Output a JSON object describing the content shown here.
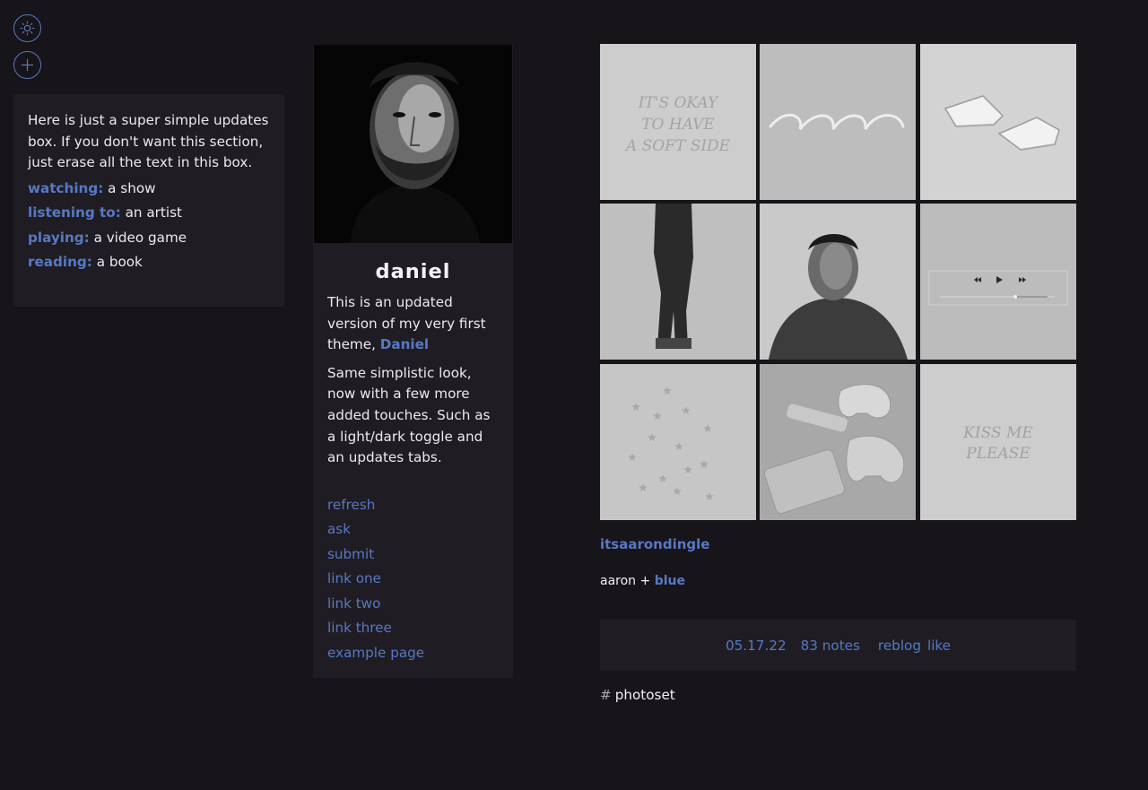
{
  "controls": {
    "theme_toggle_icon": "sun-icon",
    "updates_toggle_icon": "plus-icon",
    "accent_color": "#5878c4"
  },
  "updates": {
    "intro": "Here is just a super simple updates box. If you don't want this section, just erase all the text in this box.",
    "items": [
      {
        "label": "watching:",
        "value": "a show"
      },
      {
        "label": "listening to:",
        "value": "an artist"
      },
      {
        "label": "playing:",
        "value": "a video game"
      },
      {
        "label": "reading:",
        "value": "a book"
      }
    ]
  },
  "sidebar": {
    "name": "daniel",
    "desc1_before": "This is an updated version of my very first theme,",
    "desc1_link": "Daniel",
    "desc2": "Same simplistic look, now with a few more added touches. Such as a light/dark toggle and an updates tabs.",
    "links": [
      "refresh",
      "ask",
      "submit",
      "link one",
      "link two",
      "link three",
      "example page"
    ]
  },
  "photoset": {
    "tile1_text": [
      "IT'S OKAY",
      "TO HAVE",
      "A SOFT SIDE"
    ],
    "tile9_text": [
      "KISS ME",
      "PLEASE"
    ]
  },
  "post": {
    "username": "itsaarondingle",
    "caption_before": "aaron +",
    "caption_link": "blue",
    "date": "05.17.22",
    "notes": "83 notes",
    "reblog": "reblog",
    "like": "like",
    "tag_hash": "#",
    "tag": "photoset"
  }
}
